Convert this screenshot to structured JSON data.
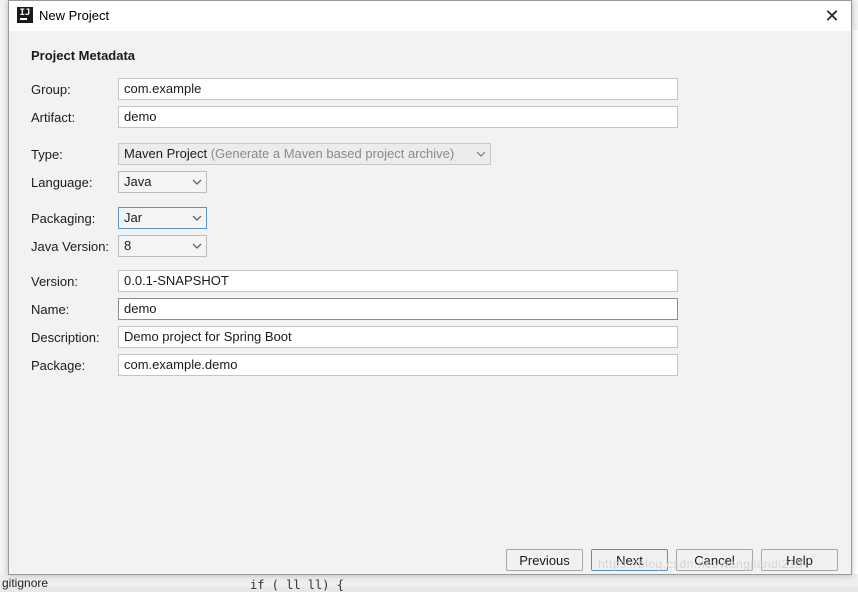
{
  "window": {
    "title": "New Project",
    "close_glyph": "✕"
  },
  "section": {
    "title": "Project Metadata"
  },
  "fields": {
    "group": {
      "label": "Group:",
      "value": "com.example"
    },
    "artifact": {
      "label": "Artifact:",
      "value": "demo"
    },
    "type": {
      "label": "Type:",
      "value": "Maven Project",
      "hint": "(Generate a Maven based project archive)"
    },
    "language": {
      "label": "Language:",
      "value": "Java"
    },
    "packaging": {
      "label": "Packaging:",
      "value": "Jar"
    },
    "java_version": {
      "label": "Java Version:",
      "value": "8"
    },
    "version": {
      "label": "Version:",
      "value": "0.0.1-SNAPSHOT"
    },
    "name": {
      "label": "Name:",
      "value": "demo"
    },
    "description": {
      "label": "Description:",
      "value": "Demo project for Spring Boot"
    },
    "package": {
      "label": "Package:",
      "value": "com.example.demo"
    }
  },
  "buttons": {
    "previous": "Previous",
    "next": "Next",
    "cancel": "Cancel",
    "help": "Help"
  },
  "background": {
    "bottom_left_text": "gitignore",
    "code_text": "if (  ll    ll) {"
  },
  "watermark": "https://blog.csdn.net/wangjiandi213",
  "colors": {
    "accent": "#5c8ec4",
    "dialog_bg": "#f2f2f2"
  }
}
